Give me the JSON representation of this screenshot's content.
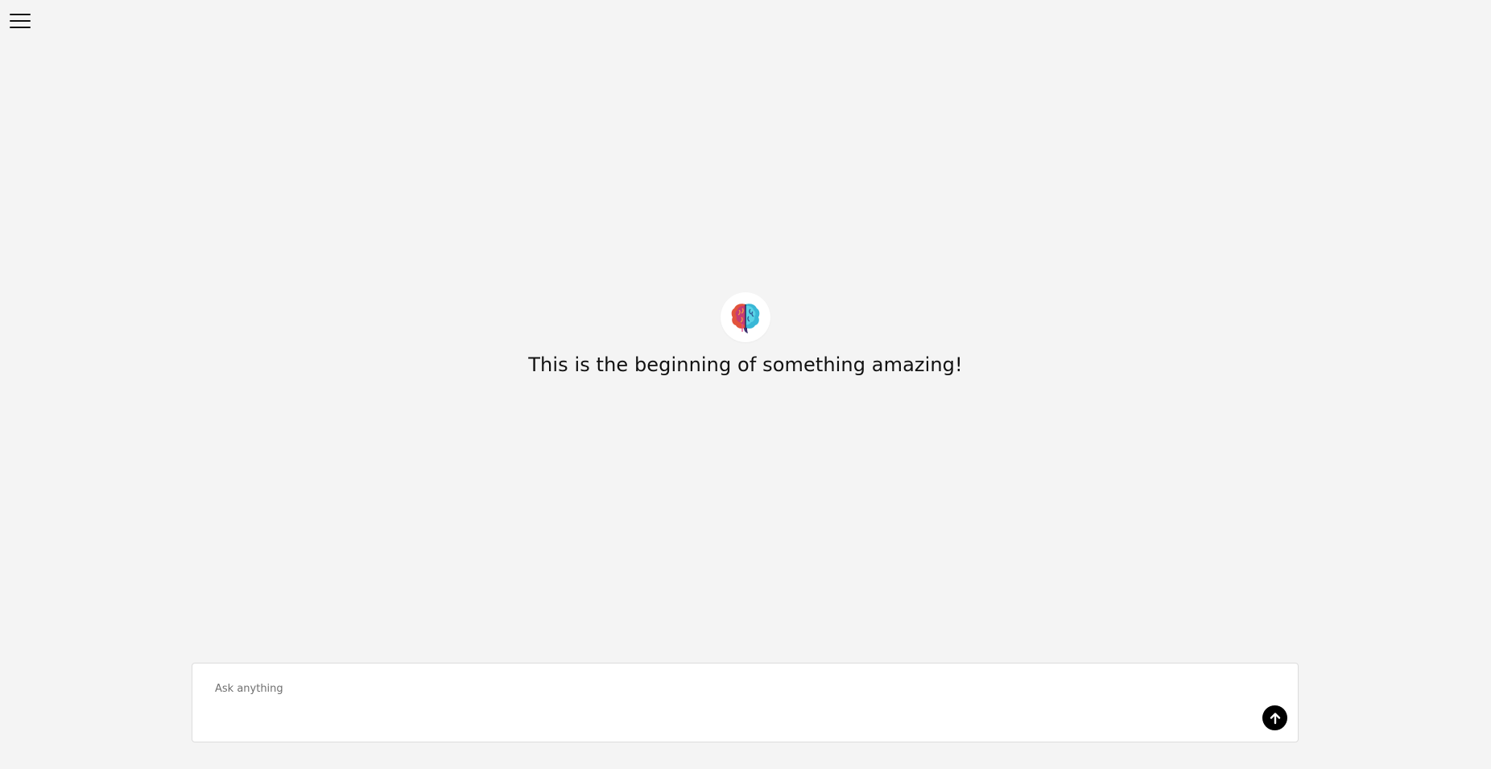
{
  "header": {
    "menu_icon": "hamburger-menu-icon"
  },
  "hero": {
    "logo_icon": "brain-icon",
    "headline": "This is the beginning of something amazing!"
  },
  "composer": {
    "placeholder": "Ask anything",
    "value": "",
    "send_icon": "arrow-up-icon"
  },
  "colors": {
    "background": "#f4f4f4",
    "composer_background": "#ffffff",
    "send_button": "#000000",
    "text": "#111111"
  }
}
